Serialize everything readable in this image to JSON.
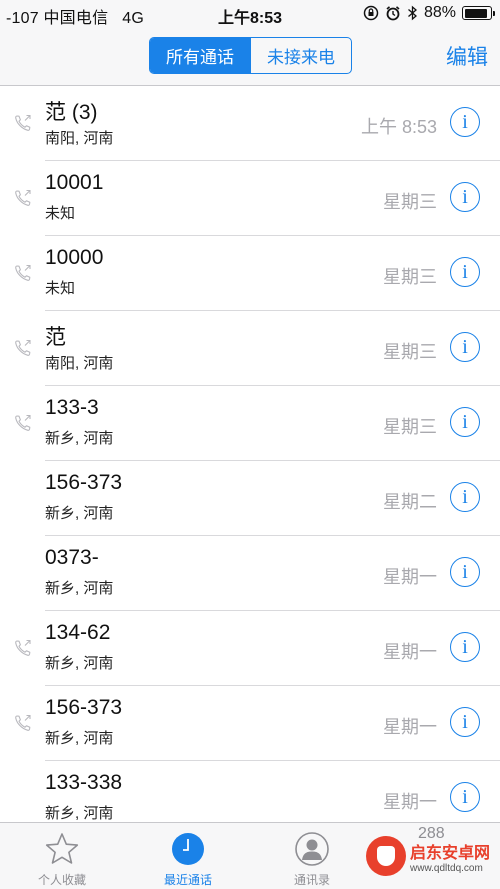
{
  "status_bar": {
    "signal": "-107",
    "carrier": "中国电信",
    "network": "4G",
    "time": "上午8:53",
    "battery_text": "88%",
    "battery_level": 0.88,
    "icons": [
      "rotation-lock-icon",
      "alarm-icon",
      "bluetooth-icon",
      "battery-icon"
    ]
  },
  "nav": {
    "segments": [
      "所有通话",
      "未接来电"
    ],
    "active_segment": 0,
    "edit_label": "编辑"
  },
  "calls": [
    {
      "name": "范 (3)",
      "location": "南阳, 河南",
      "time": "上午 8:53",
      "outgoing": true
    },
    {
      "name": "10001",
      "location": "未知",
      "time": "星期三",
      "outgoing": true
    },
    {
      "name": "10000",
      "location": "未知",
      "time": "星期三",
      "outgoing": true
    },
    {
      "name": "范",
      "location": "南阳, 河南",
      "time": "星期三",
      "outgoing": true
    },
    {
      "name": "133-3",
      "location": "新乡, 河南",
      "time": "星期三",
      "outgoing": true
    },
    {
      "name": "156-373",
      "location": "新乡, 河南",
      "time": "星期二",
      "outgoing": false
    },
    {
      "name": "0373-",
      "location": "新乡, 河南",
      "time": "星期一",
      "outgoing": false
    },
    {
      "name": "134-62",
      "location": "新乡, 河南",
      "time": "星期一",
      "outgoing": true
    },
    {
      "name": "156-373",
      "location": "新乡, 河南",
      "time": "星期一",
      "outgoing": true
    },
    {
      "name": "133-338",
      "location": "新乡, 河南",
      "time": "星期一",
      "outgoing": false
    }
  ],
  "tab_bar": {
    "tabs": [
      {
        "label": "个人收藏",
        "icon": "star-icon",
        "active": false
      },
      {
        "label": "最近通话",
        "icon": "clock-icon",
        "active": true
      },
      {
        "label": "通讯录",
        "icon": "contacts-icon",
        "active": false
      }
    ],
    "extra_text": "288"
  },
  "watermark": {
    "title": "启东安卓网",
    "url": "www.qdltdq.com"
  },
  "colors": {
    "accent": "#1a82e8",
    "secondary_text": "#a9a9ae",
    "watermark": "#e8402c"
  }
}
